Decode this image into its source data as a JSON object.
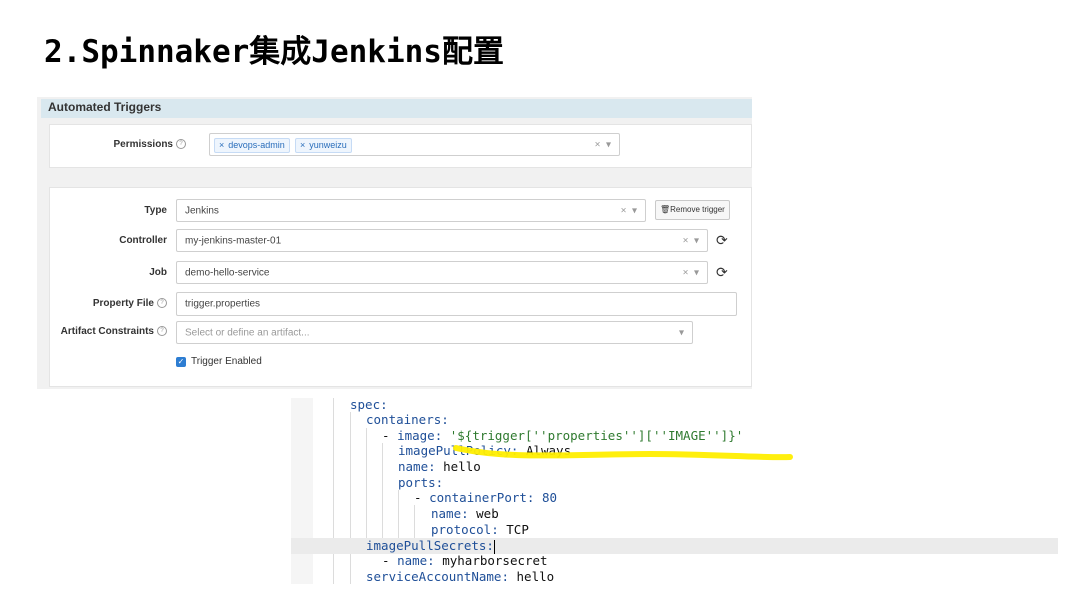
{
  "slide": {
    "title": "2.Spinnaker集成Jenkins配置"
  },
  "panel": {
    "header": "Automated Triggers",
    "permissions": {
      "label": "Permissions",
      "tags": [
        "devops-admin",
        "yunweizu"
      ]
    },
    "type": {
      "label": "Type",
      "value": "Jenkins",
      "remove_button": "Remove trigger"
    },
    "controller": {
      "label": "Controller",
      "value": "my-jenkins-master-01"
    },
    "job": {
      "label": "Job",
      "value": "demo-hello-service"
    },
    "property_file": {
      "label": "Property File",
      "value": "trigger.properties"
    },
    "artifact_constraints": {
      "label": "Artifact Constraints",
      "placeholder": "Select or define an artifact..."
    },
    "trigger_enabled": {
      "label": "Trigger Enabled",
      "checked": true
    }
  },
  "code": {
    "lines": [
      {
        "key": "spec:"
      },
      {
        "key": "containers:"
      },
      {
        "dash": "- ",
        "key": "image: ",
        "str": "'${trigger[''properties''][''IMAGE'']}'"
      },
      {
        "key": "imagePullPolicy: ",
        "val": "Always"
      },
      {
        "key": "name: ",
        "val": "hello"
      },
      {
        "key": "ports:"
      },
      {
        "dash": "- ",
        "key": "containerPort: ",
        "num": "80"
      },
      {
        "key": "name: ",
        "val": "web"
      },
      {
        "key": "protocol: ",
        "val": "TCP"
      },
      {
        "key": "imagePullSecrets:"
      },
      {
        "dash": "- ",
        "key": "name: ",
        "val": "myharborsecret"
      },
      {
        "key": "serviceAccountName: ",
        "val": "hello"
      }
    ],
    "highlight_color": "#ffee00"
  },
  "colors": {
    "accent": "#2d7dd2",
    "header_bg": "#d9e8ef"
  }
}
